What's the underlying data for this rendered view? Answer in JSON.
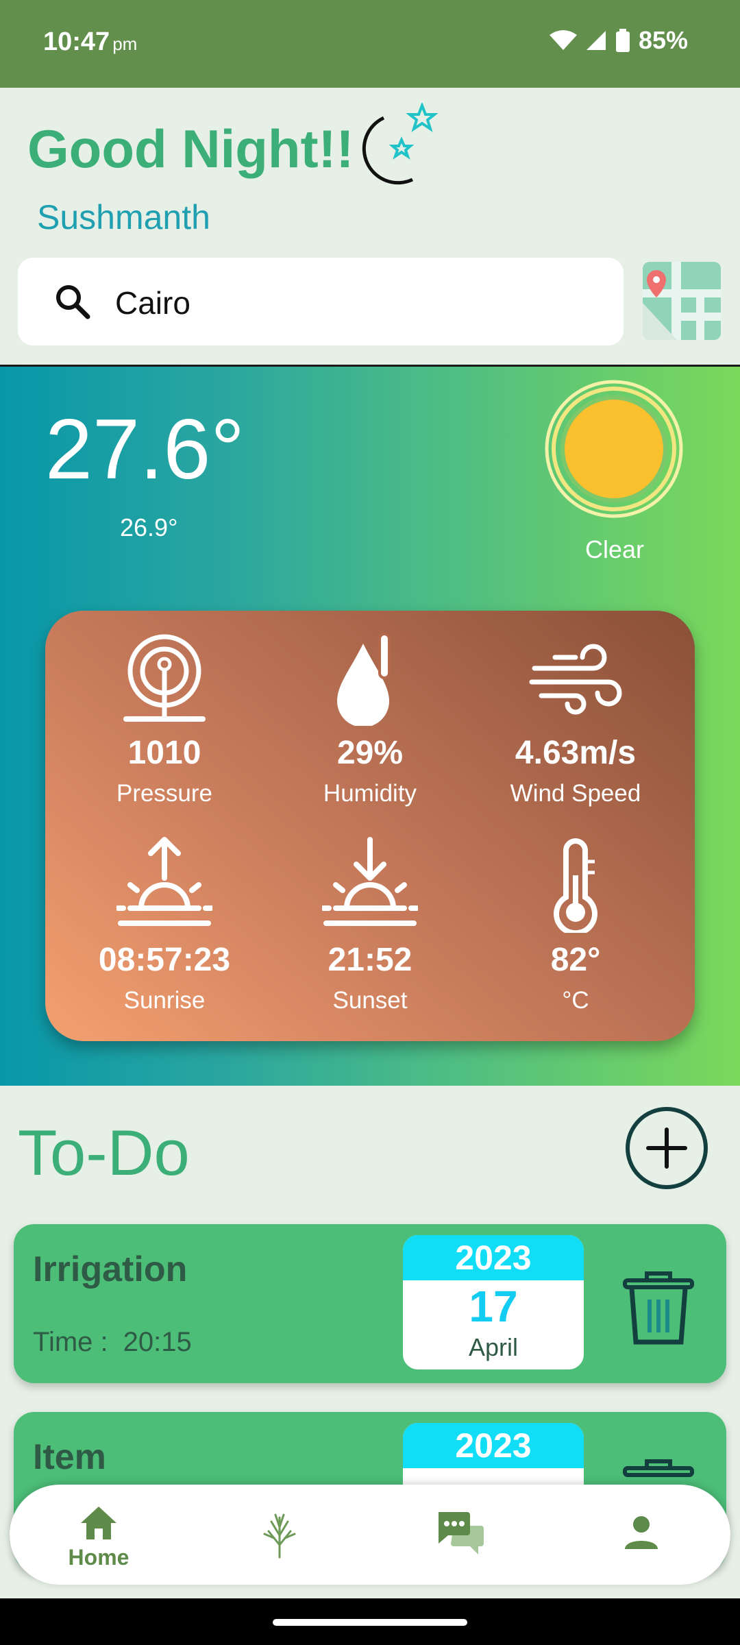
{
  "status_bar": {
    "time": "10:47",
    "ampm": "pm",
    "battery": "85%"
  },
  "header": {
    "greeting": "Good Night!!",
    "user_name": "Sushmanth"
  },
  "search": {
    "value": "Cairo"
  },
  "weather": {
    "temperature": "27.6°",
    "feels_like": "26.9°",
    "condition": "Clear",
    "stats": [
      {
        "value": "1010",
        "label": "Pressure",
        "icon": "pressure-gauge-icon"
      },
      {
        "value": "29%",
        "label": "Humidity",
        "icon": "humidity-drop-icon"
      },
      {
        "value": "4.63m/s",
        "label": "Wind Speed",
        "icon": "wind-icon"
      },
      {
        "value": "08:57:23",
        "label": "Sunrise",
        "icon": "sunrise-icon"
      },
      {
        "value": "21:52",
        "label": "Sunset",
        "icon": "sunset-icon"
      },
      {
        "value": "82°",
        "label": "°C",
        "icon": "thermometer-icon"
      }
    ]
  },
  "todo": {
    "title": "To-Do",
    "items": [
      {
        "name": "Irrigation",
        "time_label": "Time :",
        "time": "20:15",
        "year": "2023",
        "day": "17",
        "month": "April"
      },
      {
        "name": "Item",
        "year": "2023"
      }
    ]
  },
  "bottom_nav": {
    "items": [
      {
        "label": "Home",
        "icon": "home-icon"
      },
      {
        "icon": "plant-icon"
      },
      {
        "icon": "chat-icon"
      },
      {
        "icon": "profile-icon"
      }
    ]
  },
  "colors": {
    "status_bar": "#628f4b",
    "accent_green": "#3cae78",
    "card_green": "#4cbe78",
    "cyan": "#12ddf7"
  }
}
